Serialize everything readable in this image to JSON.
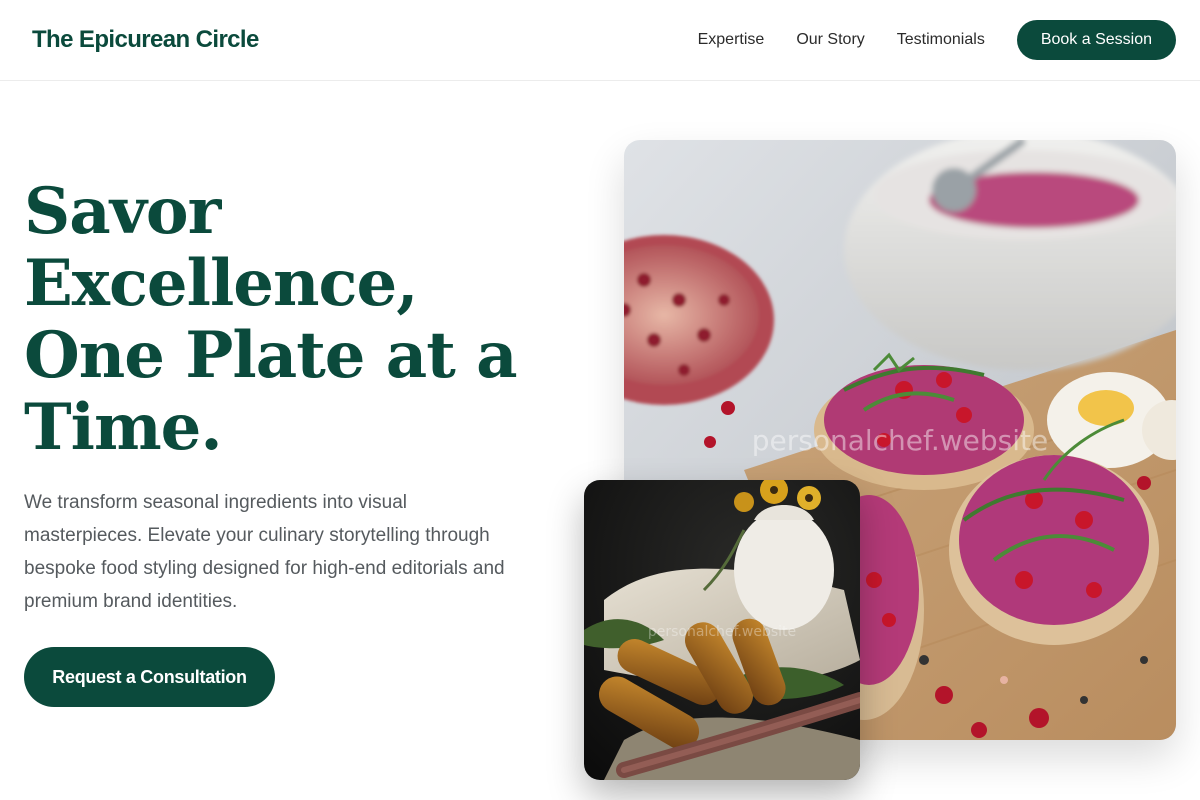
{
  "header": {
    "brand": "The Epicurean Circle",
    "nav": [
      "Expertise",
      "Our Story",
      "Testimonials"
    ],
    "cta_label": "Book a Session"
  },
  "hero": {
    "title": "Savor Excellence, One Plate at a Time.",
    "description": "We transform seasonal ingredients into visual masterpieces. Elevate your culinary storytelling through bespoke food styling designed for high-end editorials and premium brand identities.",
    "cta_label": "Request a Consultation"
  },
  "photos": {
    "main_watermark": "personalchef.website",
    "inset_watermark": "personalchef.website"
  },
  "colors": {
    "brand_green": "#0b4a3c",
    "body_text": "#555a5e",
    "nav_text": "#2b2b2b"
  }
}
